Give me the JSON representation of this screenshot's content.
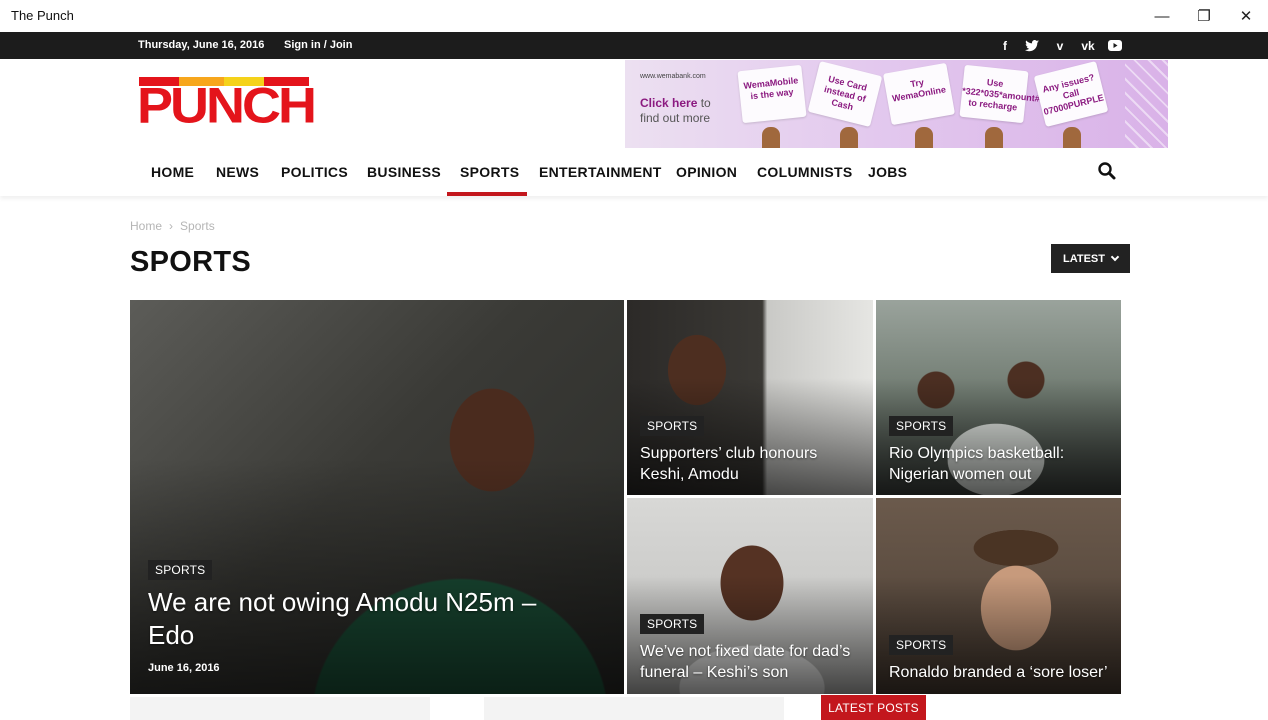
{
  "window": {
    "title": "The Punch",
    "minimize": "—",
    "maximize": "❐",
    "close": "✕"
  },
  "topbar": {
    "date": "Thursday, June 16, 2016",
    "signin": "Sign in / Join",
    "social": [
      {
        "name": "facebook-icon",
        "glyph": "f"
      },
      {
        "name": "twitter-icon",
        "glyph": "t"
      },
      {
        "name": "vimeo-icon",
        "glyph": "v"
      },
      {
        "name": "vk-icon",
        "glyph": "vk"
      },
      {
        "name": "youtube-icon",
        "glyph": "▶"
      }
    ]
  },
  "logo": {
    "text": "PUNCH",
    "stripe_colors": [
      "#e4141b",
      "#f7a61c",
      "#f5d21a",
      "#e4141b"
    ]
  },
  "ad": {
    "url": "www.wemabank.com",
    "click": "Click here",
    "click_suffix": " to",
    "find": "find out more",
    "cards": [
      "WemaMobile is the way",
      "Use Card instead of Cash",
      "Try WemaOnline",
      "Use *322*035*amount# to recharge",
      "Any issues? Call 07000PURPLE"
    ]
  },
  "nav": {
    "items": [
      "HOME",
      "NEWS",
      "POLITICS",
      "BUSINESS",
      "SPORTS",
      "ENTERTAINMENT",
      "OPINION",
      "COLUMNISTS",
      "JOBS"
    ],
    "active": "SPORTS"
  },
  "breadcrumb": {
    "home": "Home",
    "sep": "›",
    "current": "Sports"
  },
  "page_title": "SPORTS",
  "sort_button": "LATEST",
  "tiles": {
    "main": {
      "category": "SPORTS",
      "headline": "We are not owing Amodu N25m – Edo",
      "date": "June 16, 2016"
    },
    "t1": {
      "category": "SPORTS",
      "headline": "Supporters’ club honours Keshi, Amodu"
    },
    "t2": {
      "category": "SPORTS",
      "headline": "Rio Olympics basketball: Nigerian women out"
    },
    "t3": {
      "category": "SPORTS",
      "headline": "We’ve not fixed date for dad’s funeral – Keshi’s son"
    },
    "t4": {
      "category": "SPORTS",
      "headline": "Ronaldo branded a ‘sore loser’"
    }
  },
  "latest_posts": "LATEST POSTS",
  "colors": {
    "accent": "#c3171d",
    "topbar": "#1c1c1c",
    "logo_red": "#e4141b"
  }
}
